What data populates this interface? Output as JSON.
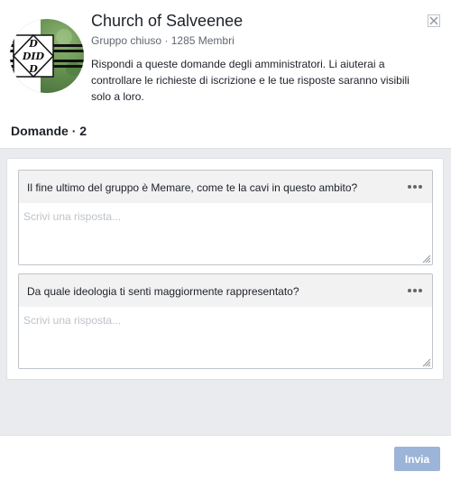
{
  "group": {
    "name": "Church of Salveenee",
    "privacy": "Gruppo chiuso",
    "separator": "·",
    "members": "1285 Membri",
    "intro": "Rispondi a queste domande degli amministratori. Li aiuterai a controllare le richieste di iscrizione e le tue risposte saranno visibili solo a loro.",
    "avatar_letters": "D",
    "avatar_letters_row": "DID",
    "avatar_letters_bottom": "D"
  },
  "questions_section": {
    "label": "Domande",
    "separator": "·",
    "count": "2"
  },
  "questions": [
    {
      "text": "Il fine ultimo del gruppo è Memare, come te la cavi in questo ambito?",
      "placeholder": "Scrivi una risposta...",
      "answer": ""
    },
    {
      "text": "Da quale ideologia ti senti maggiormente rappresentato?",
      "placeholder": "Scrivi una risposta...",
      "answer": ""
    }
  ],
  "actions": {
    "send_label": "Invia"
  },
  "icons": {
    "close": "close-icon",
    "more": "more-options-icon",
    "resize": "resize-grip-icon"
  },
  "colors": {
    "send_button": "#9cb4d8",
    "panel_background": "#e9ebee",
    "question_header": "#f2f2f2"
  }
}
